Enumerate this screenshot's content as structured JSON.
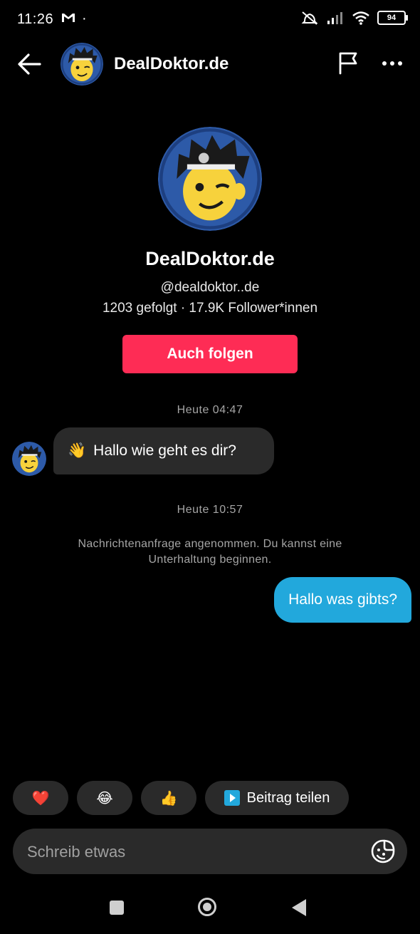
{
  "status_bar": {
    "time": "11:26",
    "dot": "·",
    "battery": "94"
  },
  "header": {
    "title": "DealDoktor.de",
    "back_icon": "arrow-left-icon",
    "report_icon": "flag-icon",
    "more_icon": "more-horizontal-icon"
  },
  "profile": {
    "name": "DealDoktor.de",
    "handle": "@dealdoktor..de",
    "stats": "1203 gefolgt · 17.9K Follower*innen",
    "follow_label": "Auch folgen"
  },
  "conversation": {
    "timestamp_1": "Heute 04:47",
    "incoming_emoji": "👋",
    "incoming_text": "Hallo wie geht es dir?",
    "timestamp_2": "Heute 10:57",
    "system_note": "Nachrichtenanfrage angenommen. Du kannst eine Unterhaltung beginnen.",
    "outgoing_text": "Hallo was gibts?"
  },
  "quick_replies": {
    "heart": "❤️",
    "laugh": "😂",
    "thumbs_up": "👍",
    "share_label": "Beitrag teilen"
  },
  "composer": {
    "placeholder": "Schreib etwas"
  },
  "colors": {
    "follow_button": "#fe2c55",
    "outgoing_bubble": "#22a8dc",
    "incoming_bubble": "#2a2a2a"
  }
}
